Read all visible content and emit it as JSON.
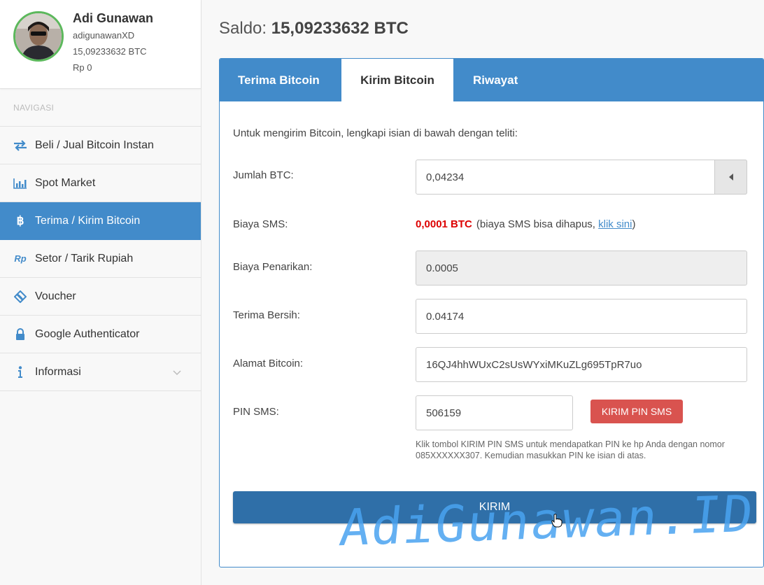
{
  "profile": {
    "name": "Adi Gunawan",
    "username": "adigunawanXD",
    "btc_balance": "15,09233632 BTC",
    "rp_balance": "Rp 0"
  },
  "nav": {
    "heading": "NAVIGASI",
    "items": [
      {
        "label": "Beli / Jual Bitcoin Instan",
        "icon": "exchange-arrows-icon"
      },
      {
        "label": "Spot Market",
        "icon": "bar-chart-icon"
      },
      {
        "label": "Terima / Kirim Bitcoin",
        "icon": "bitcoin-icon",
        "active": true
      },
      {
        "label": "Setor / Tarik Rupiah",
        "icon": "rupiah-icon"
      },
      {
        "label": "Voucher",
        "icon": "ticket-icon"
      },
      {
        "label": "Google Authenticator",
        "icon": "lock-icon"
      },
      {
        "label": "Informasi",
        "icon": "info-icon",
        "has_submenu": true
      }
    ]
  },
  "saldo": {
    "label": "Saldo:",
    "value": "15,09233632 BTC"
  },
  "tabs": [
    {
      "label": "Terima Bitcoin"
    },
    {
      "label": "Kirim Bitcoin",
      "active": true
    },
    {
      "label": "Riwayat"
    }
  ],
  "form": {
    "intro": "Untuk mengirim Bitcoin, lengkapi isian di bawah dengan teliti:",
    "jumlah_label": "Jumlah BTC:",
    "jumlah_value": "0,04234",
    "biaya_sms_label": "Biaya SMS:",
    "biaya_sms_value": "0,0001 BTC",
    "biaya_sms_note_pre": "(biaya SMS bisa dihapus, ",
    "biaya_sms_link": "klik sini",
    "biaya_sms_note_post": ")",
    "penarikan_label": "Biaya Penarikan:",
    "penarikan_value": "0.0005",
    "bersih_label": "Terima Bersih:",
    "bersih_value": "0.04174",
    "alamat_label": "Alamat Bitcoin:",
    "alamat_value": "16QJ4hhWUxC2sUsWYxiMKuZLg695TpR7uo",
    "pin_label": "PIN SMS:",
    "pin_value": "506159",
    "pin_button": "KIRIM PIN SMS",
    "pin_help": "Klik tombol KIRIM PIN SMS untuk mendapatkan PIN ke hp Anda dengan nomor 085XXXXXX307. Kemudian masukkan PIN ke isian di atas.",
    "submit": "KIRIM"
  },
  "watermark": "AdiGunawan.ID",
  "colors": {
    "primary": "#428bca",
    "danger": "#d9534f",
    "submit": "#2f6fa8",
    "avatar_ring": "#5cb85c"
  }
}
